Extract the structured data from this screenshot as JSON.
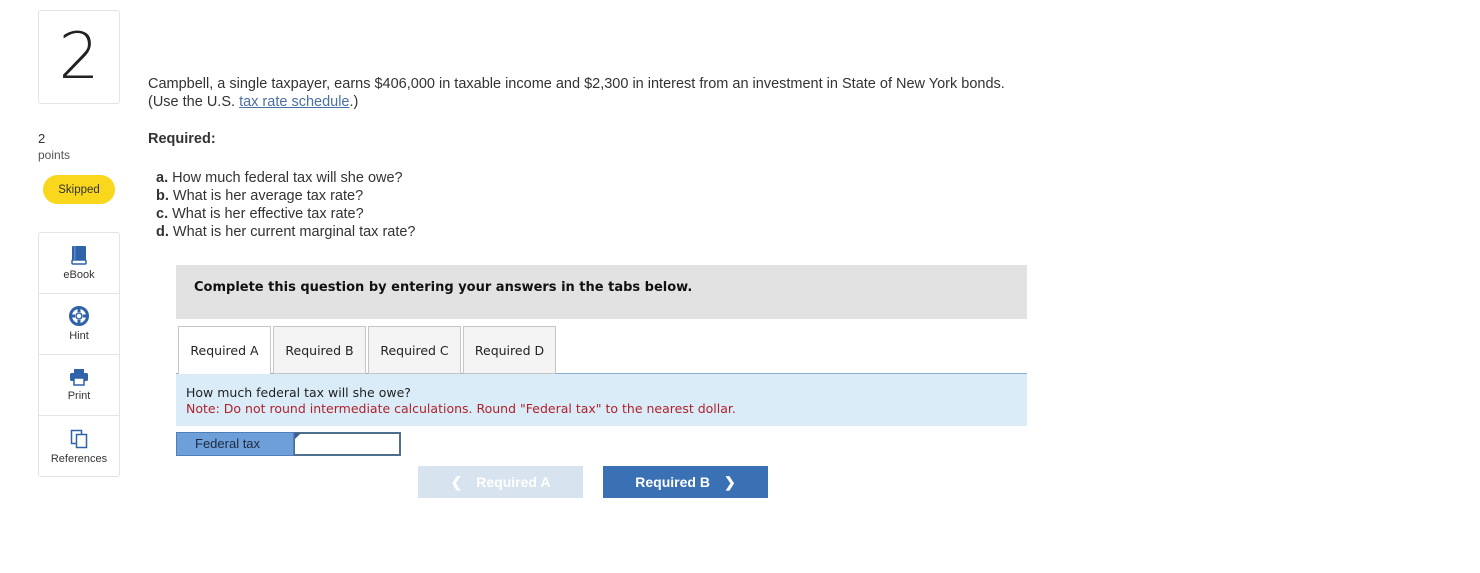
{
  "question": {
    "number": "2",
    "points_value": "2",
    "points_label": "points",
    "status": "Skipped"
  },
  "tools": [
    {
      "label": "eBook",
      "icon": "book-icon"
    },
    {
      "label": "Hint",
      "icon": "lifebuoy-icon"
    },
    {
      "label": "Print",
      "icon": "printer-icon"
    },
    {
      "label": "References",
      "icon": "copy-icon"
    }
  ],
  "prompt": {
    "line1": "Campbell, a single taxpayer, earns $406,000 in taxable income and $2,300 in interest from an investment in State of New York bonds.",
    "line2_prefix": "(Use the U.S. ",
    "link_text": "tax rate schedule",
    "line2_suffix": ".)"
  },
  "required_heading": "Required:",
  "parts": [
    {
      "letter": "a.",
      "text": "How much federal tax will she owe?"
    },
    {
      "letter": "b.",
      "text": "What is her average tax rate?"
    },
    {
      "letter": "c.",
      "text": "What is her effective tax rate?"
    },
    {
      "letter": "d.",
      "text": "What is her current marginal tax rate?"
    }
  ],
  "instructions": "Complete this question by entering your answers in the tabs below.",
  "tabs": [
    "Required A",
    "Required B",
    "Required C",
    "Required D"
  ],
  "active_tab": "Required A",
  "panel": {
    "question": "How much federal tax will she owe?",
    "note": "Note: Do not round intermediate calculations. Round \"Federal tax\" to the nearest dollar."
  },
  "answer": {
    "label": "Federal tax",
    "value": ""
  },
  "nav": {
    "prev_label": "Required A",
    "next_label": "Required B"
  },
  "colors": {
    "badge": "#f9d71c",
    "next_button": "#3a71b4",
    "prev_button_disabled": "#d8e3f0",
    "note_text": "#b0222c",
    "panel_bg": "#d9ecf8",
    "answer_label_bg": "#6f9fd8"
  }
}
